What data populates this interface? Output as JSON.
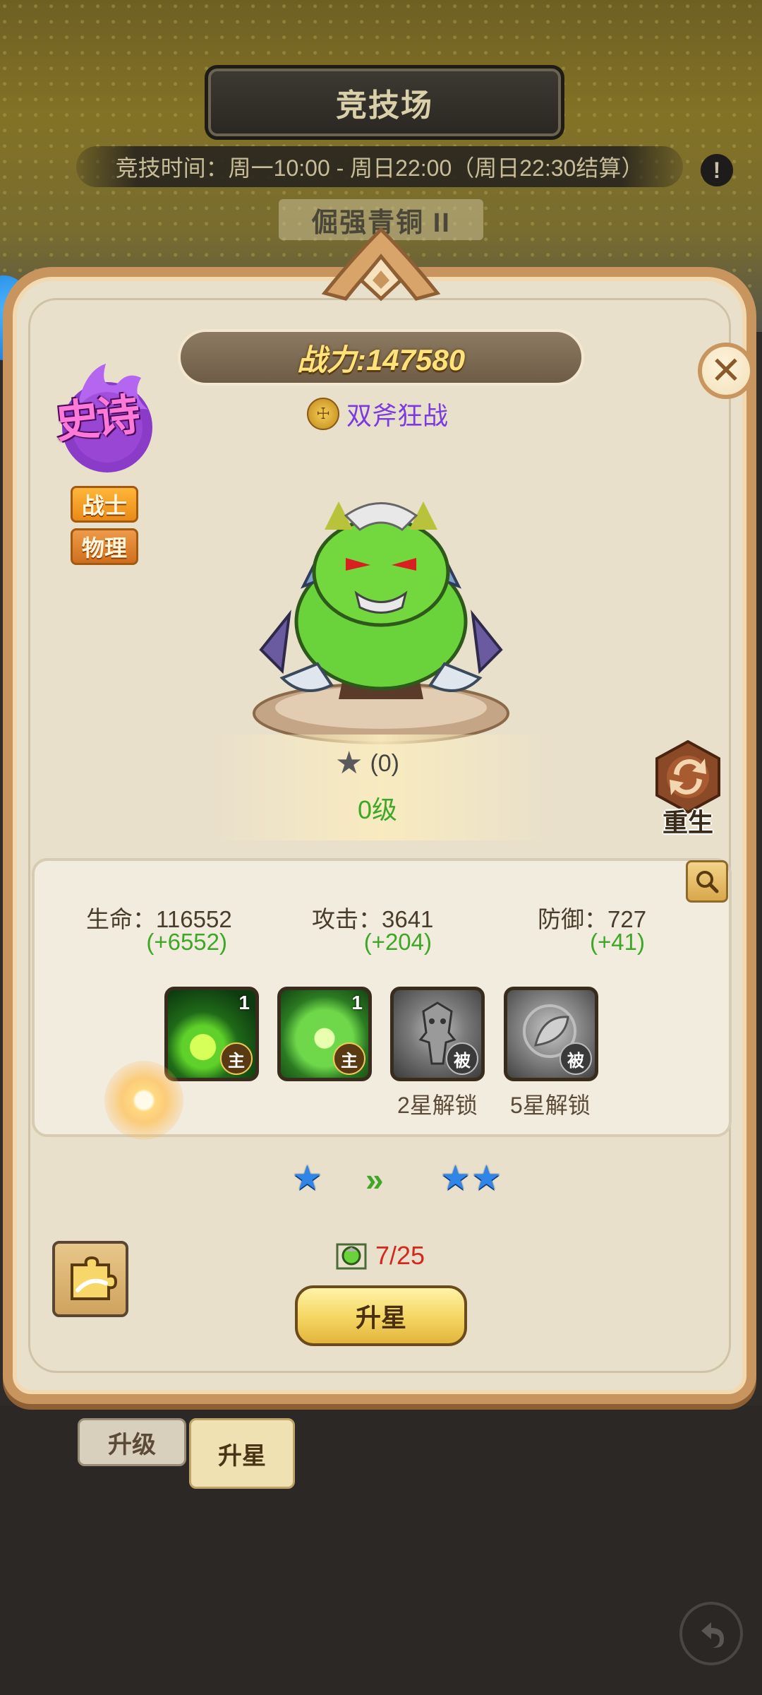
{
  "arena": {
    "title": "竞技场",
    "time": "竞技时间：周一10:00 - 周日22:00（周日22:30结算）",
    "rank": "倔强青铜 II"
  },
  "hero": {
    "power": "战力:147580",
    "name": "双斧狂战",
    "rarity": "史诗",
    "class_tag": "战士",
    "damage_tag": "物理",
    "star_count": "(0)",
    "level": "0级",
    "rebirth_label": "重生"
  },
  "stats": {
    "hp_label": "生命：116552",
    "hp_bonus": "(+6552)",
    "atk_label": "攻击：3641",
    "atk_bonus": "(+204)",
    "def_label": "防御：727",
    "def_bonus": "(+41)"
  },
  "skills": [
    {
      "level": "1",
      "kind": "主"
    },
    {
      "level": "1",
      "kind": "主"
    },
    {
      "kind": "被",
      "unlock": "2星解锁"
    },
    {
      "kind": "被",
      "unlock": "5星解锁"
    }
  ],
  "star_upgrade": {
    "shard_count": "7/25",
    "button_label": "升星"
  },
  "tabs": {
    "upgrade": "升级",
    "star": "升星"
  },
  "icons": {
    "close": "close-icon",
    "info": "info-icon",
    "magnify": "magnify-icon",
    "rebirth": "rebirth-icon",
    "puzzle": "puzzle-icon",
    "back": "back-icon"
  }
}
